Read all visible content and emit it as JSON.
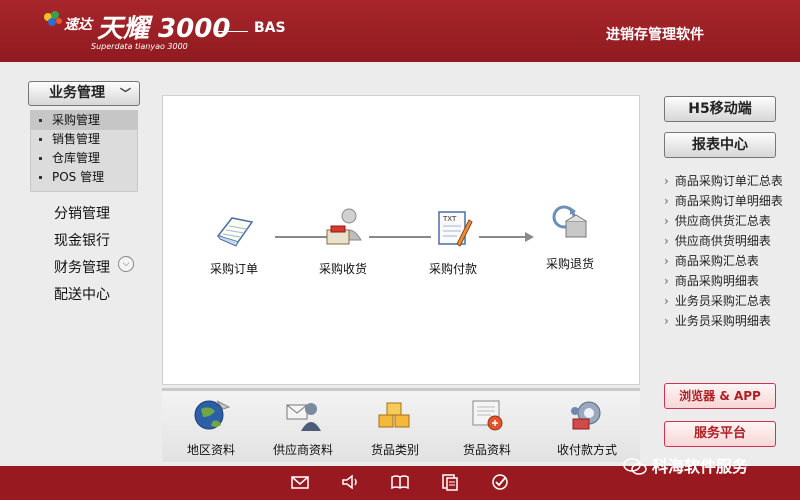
{
  "header": {
    "brand_small": "速达",
    "brand_big": "天耀 3000",
    "brand_bas": "BAS",
    "brand_sub": "Superdata tianyao 3000",
    "app_title": "进销存管理软件"
  },
  "sidebar": {
    "menu_label": "业务管理",
    "submenu": [
      "采购管理",
      "销售管理",
      "仓库管理",
      "POS 管理"
    ],
    "items": [
      "分销管理",
      "现金银行",
      "财务管理",
      "配送中心"
    ]
  },
  "flow": {
    "steps": [
      "采购订单",
      "采购收货",
      "采购付款",
      "采购退货"
    ]
  },
  "bottom": {
    "items": [
      "地区资料",
      "供应商资料",
      "货品类别",
      "货品资料",
      "收付款方式"
    ]
  },
  "right": {
    "h5_label": "H5移动端",
    "report_center": "报表中心",
    "reports": [
      "商品采购订单汇总表",
      "商品采购订单明细表",
      "供应商供货汇总表",
      "供应商供货明细表",
      "商品采购汇总表",
      "商品采购明细表",
      "业务员采购汇总表",
      "业务员采购明细表"
    ],
    "browser_app": "浏览器 & APP",
    "service_platform": "服务平台"
  },
  "watermark": "科海软件服务",
  "colors": {
    "brand_red": "#98191f",
    "header_red": "#a8262b"
  },
  "footer_icons": [
    "mail-icon",
    "speaker-icon",
    "book-icon",
    "notes-icon",
    "check-circle-icon"
  ]
}
